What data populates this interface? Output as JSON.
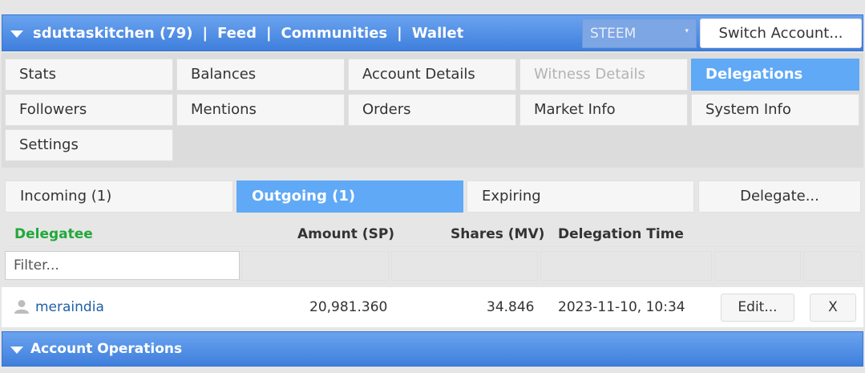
{
  "header": {
    "nav": [
      "sduttaskitchen (79)",
      "Feed",
      "Communities",
      "Wallet"
    ],
    "separator": "|",
    "token_select": "STEEM",
    "switch_account": "Switch Account..."
  },
  "tabs": [
    {
      "label": "Stats",
      "state": "normal"
    },
    {
      "label": "Balances",
      "state": "normal"
    },
    {
      "label": "Account Details",
      "state": "normal"
    },
    {
      "label": "Witness Details",
      "state": "disabled"
    },
    {
      "label": "Delegations",
      "state": "active"
    },
    {
      "label": "Followers",
      "state": "normal"
    },
    {
      "label": "Mentions",
      "state": "normal"
    },
    {
      "label": "Orders",
      "state": "normal"
    },
    {
      "label": "Market Info",
      "state": "normal"
    },
    {
      "label": "System Info",
      "state": "normal"
    },
    {
      "label": "Settings",
      "state": "normal"
    }
  ],
  "subtabs": {
    "incoming": "Incoming (1)",
    "outgoing": "Outgoing (1)",
    "expiring": "Expiring",
    "delegate": "Delegate..."
  },
  "table": {
    "columns": [
      "Delegatee",
      "Amount (SP)",
      "Shares (MV)",
      "Delegation Time"
    ],
    "filter_placeholder": "Filter...",
    "rows": [
      {
        "delegatee": "meraindia",
        "amount": "20,981.360",
        "shares": "34.846",
        "time": "2023-11-10, 10:34",
        "edit": "Edit...",
        "remove": "X"
      }
    ]
  },
  "footer": {
    "title": "Account Operations"
  },
  "colors": {
    "accent": "#3f7fdc",
    "active_tab": "#5fa9f6",
    "delegatee_header": "#22a83a",
    "link": "#1f5fa8"
  }
}
